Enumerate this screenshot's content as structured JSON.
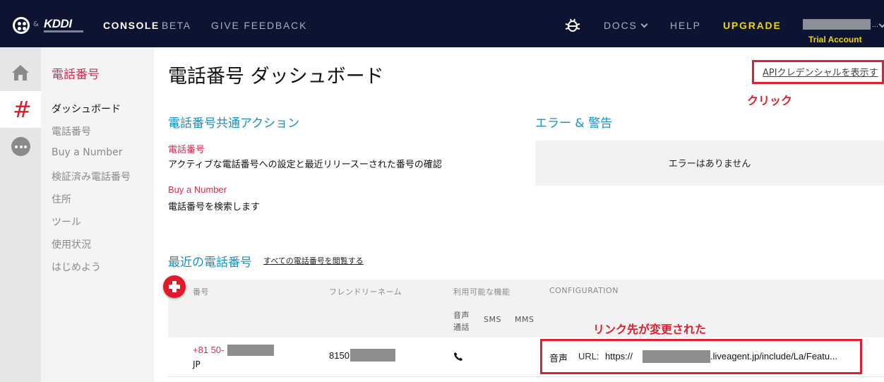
{
  "header": {
    "amp": "&",
    "brand": "KDDI",
    "console_label": "CONSOLE",
    "beta_label": "BETA",
    "feedback_label": "GIVE FEEDBACK",
    "docs_label": "DOCS",
    "help_label": "HELP",
    "upgrade_label": "UPGRADE",
    "account_suffix": "...",
    "account_type": "Trial Account"
  },
  "sidebar": {
    "title": "電話番号",
    "items": [
      {
        "label": "ダッシュボード",
        "active": true
      },
      {
        "label": "電話番号"
      },
      {
        "label": "Buy a Number"
      },
      {
        "label": "検証済み電話番号"
      },
      {
        "label": "住所"
      },
      {
        "label": "ツール"
      },
      {
        "label": "使用状況"
      },
      {
        "label": "はじめよう"
      }
    ]
  },
  "main": {
    "title": "電話番号 ダッシュボード",
    "api_link": "APIクレデンシャルを表示す",
    "annotation_click": "クリック",
    "annotation_link": "リンク先が変更された",
    "common_actions": {
      "heading": "電話番号共通アクション",
      "items": [
        {
          "link": "電話番号",
          "desc": "アクティブな電話番号への設定と最近リリースーされた番号の確認"
        },
        {
          "link": "Buy a Number",
          "desc": "電話番号を検索します"
        }
      ]
    },
    "errors": {
      "heading": "エラー & 警告",
      "empty": "エラーはありません"
    },
    "recent": {
      "heading": "最近の電話番号",
      "view_all": "すべての電話番号を閲覧する",
      "columns": {
        "number": "番号",
        "friendly": "フレンドリーネーム",
        "capabilities": "利用可能な機能",
        "configuration": "CONFIGURATION",
        "voice": "音声通話",
        "voice_l1": "音声",
        "voice_l2": "通話",
        "sms": "SMS",
        "mms": "MMS"
      },
      "rows": [
        {
          "number_prefix": "+81 50-",
          "country": "JP",
          "friendly_prefix": "8150",
          "config_label": "音声",
          "url_label": "URL:",
          "url_prefix": "https://",
          "url_suffix": ".liveagent.jp/include/La/Featu..."
        }
      ]
    }
  },
  "colors": {
    "topbar": "#0d1432",
    "accent_red": "#e0192b",
    "link_red": "#d03050",
    "heading_blue": "#1a8fc4",
    "upgrade_yellow": "#ecd700"
  }
}
